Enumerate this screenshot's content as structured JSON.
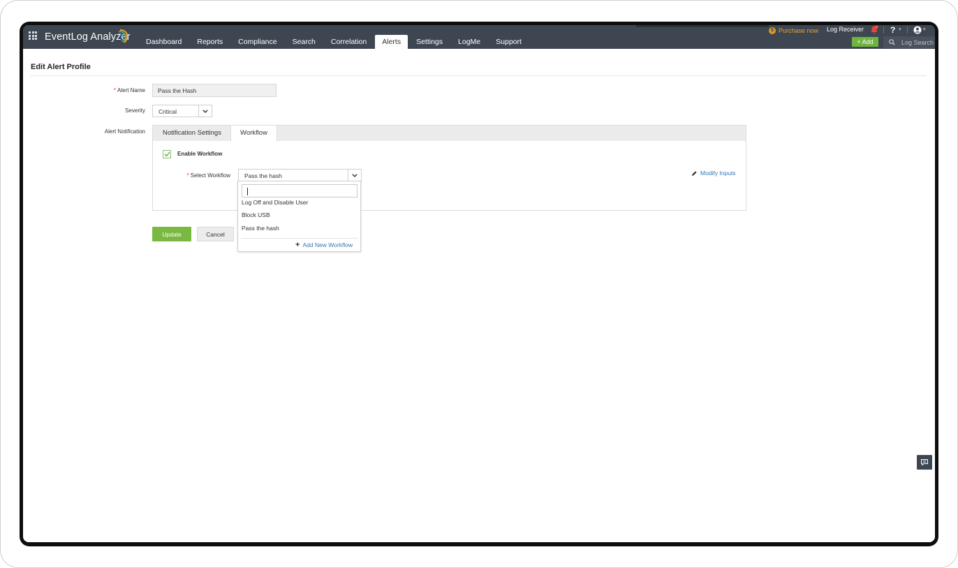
{
  "app": {
    "name": "EventLog Analyzer"
  },
  "nav": {
    "tabs": [
      {
        "label": "Dashboard"
      },
      {
        "label": "Reports"
      },
      {
        "label": "Compliance"
      },
      {
        "label": "Search"
      },
      {
        "label": "Correlation"
      },
      {
        "label": "Alerts",
        "active": true
      },
      {
        "label": "Settings"
      },
      {
        "label": "LogMe"
      },
      {
        "label": "Support"
      }
    ]
  },
  "header": {
    "purchase_label": "Purchase now",
    "log_receiver_label": "Log Receiver",
    "help_label": "?",
    "add_label": "+ Add",
    "log_search_placeholder": "Log Search"
  },
  "page": {
    "title": "Edit Alert Profile"
  },
  "form": {
    "alert_name_label": "Alert Name",
    "alert_name_value": "Pass the Hash",
    "severity_label": "Severity",
    "severity_value": "Critical",
    "alert_notification_label": "Alert Notification",
    "required_marker": "*"
  },
  "panel": {
    "tabs": [
      {
        "label": "Notification Settings"
      },
      {
        "label": "Workflow",
        "active": true
      }
    ],
    "enable_workflow_label": "Enable Workflow",
    "enable_workflow_checked": true,
    "select_workflow_label": "Select Workflow",
    "select_workflow_value": "Pass the hash",
    "modify_inputs_label": "Modify Inputs"
  },
  "dropdown": {
    "search_value": "",
    "options": [
      {
        "label": "Log Off and Disable User"
      },
      {
        "label": "Block USB"
      },
      {
        "label": "Pass the hash"
      }
    ],
    "add_new_label": "Add New Workflow"
  },
  "actions": {
    "update_label": "Update",
    "cancel_label": "Cancel"
  },
  "colors": {
    "topbar": "#3e4751",
    "accent_green": "#79b941",
    "link_blue": "#2f79b9",
    "required_red": "#d9342b"
  }
}
